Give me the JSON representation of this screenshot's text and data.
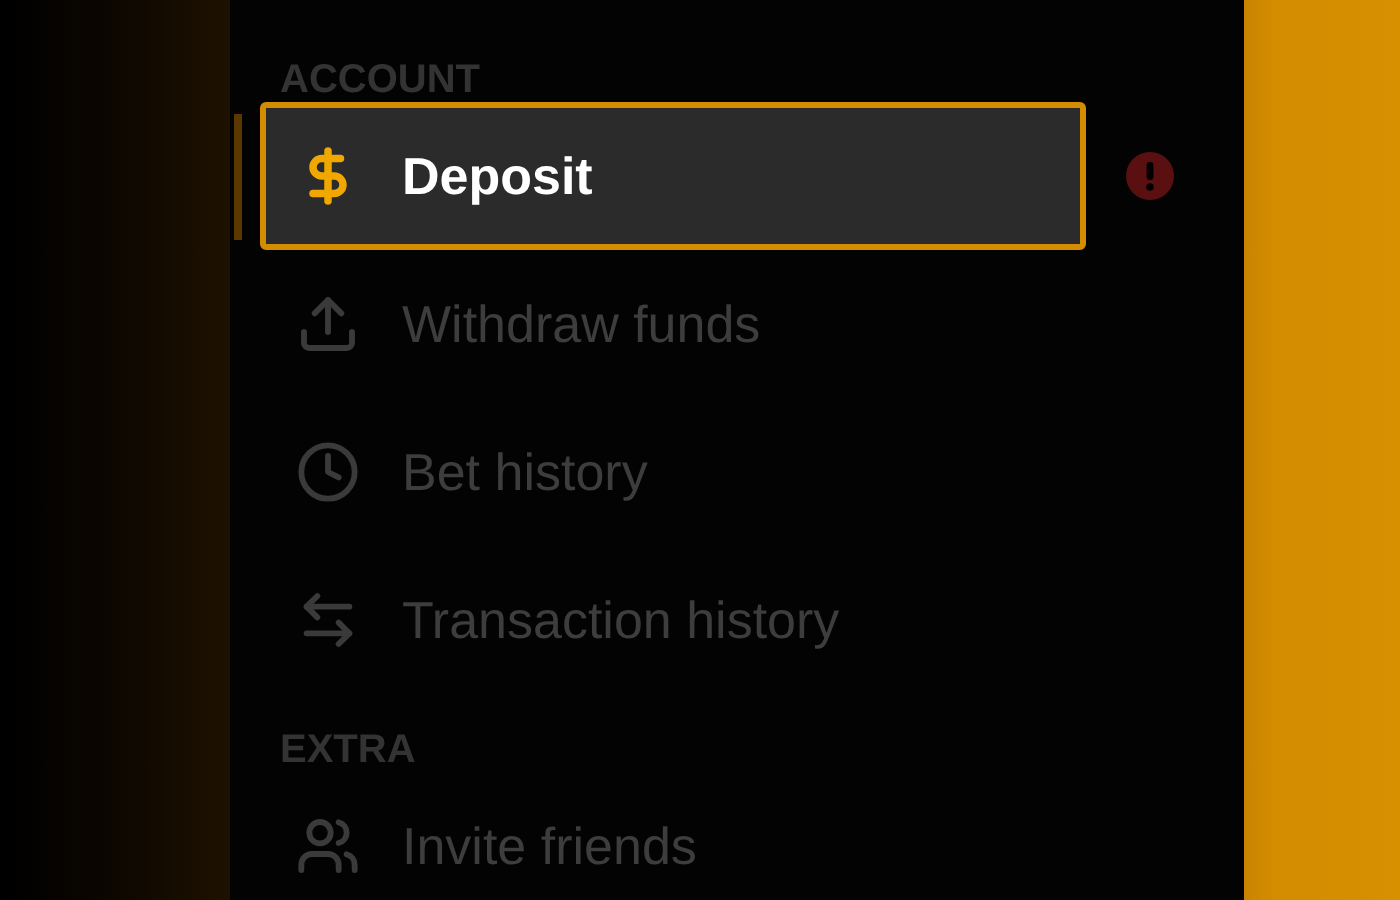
{
  "sections": [
    {
      "heading": "ACCOUNT",
      "items": [
        {
          "label": "Deposit",
          "kind": "dollar",
          "selected": true,
          "alert": true
        },
        {
          "label": "Withdraw funds",
          "kind": "upload",
          "selected": false,
          "alert": false
        },
        {
          "label": "Bet history",
          "kind": "clock",
          "selected": false,
          "alert": false
        },
        {
          "label": "Transaction history",
          "kind": "transfer",
          "selected": false,
          "alert": false
        }
      ]
    },
    {
      "heading": "EXTRA",
      "items": [
        {
          "label": "Invite friends",
          "kind": "people",
          "selected": false,
          "alert": false
        }
      ]
    }
  ]
}
